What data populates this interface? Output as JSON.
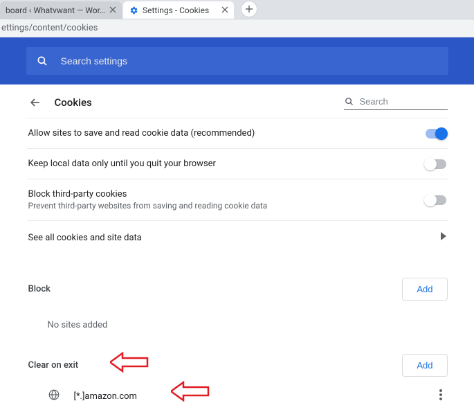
{
  "tabs": {
    "inactive_label": "board ‹ Whatvwant — Wor…",
    "active_label": "Settings - Cookies"
  },
  "address_bar": "ettings/content/cookies",
  "top_search": {
    "placeholder": "Search settings"
  },
  "page": {
    "title": "Cookies",
    "search_placeholder": "Search"
  },
  "rows": {
    "allow": "Allow sites to save and read cookie data (recommended)",
    "keep_local": "Keep local data only until you quit your browser",
    "block3p_title": "Block third-party cookies",
    "block3p_sub": "Prevent third-party websites from saving and reading cookie data",
    "see_all": "See all cookies and site data"
  },
  "sections": {
    "block": "Block",
    "clear_on_exit": "Clear on exit",
    "add_label": "Add",
    "no_sites": "No sites added"
  },
  "sites": {
    "clear_on_exit_0": "[*.]amazon.com"
  }
}
